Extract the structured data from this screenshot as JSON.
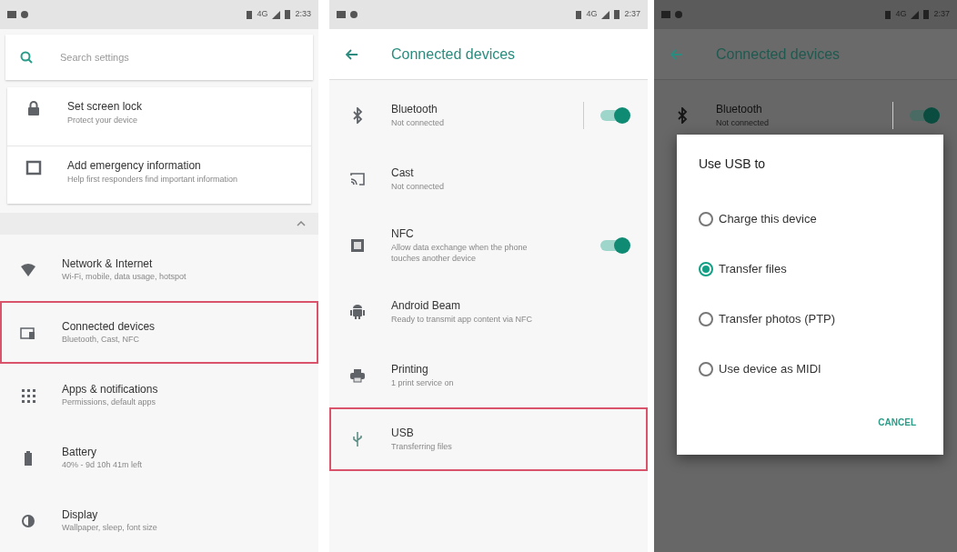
{
  "panels": [
    {
      "kind": "home",
      "status_bar": {
        "network": "4G",
        "time": "2:33"
      },
      "search": {
        "placeholder": "Search settings"
      },
      "suggestions": [
        {
          "title": "Set screen lock",
          "summary": "Protect your device"
        },
        {
          "title": "Add emergency information",
          "summary": "Help first responders find important information"
        }
      ],
      "items": [
        {
          "title": "Network & Internet",
          "summary": "Wi-Fi, mobile, data usage, hotspot",
          "highlighted": false
        },
        {
          "title": "Connected devices",
          "summary": "Bluetooth, Cast, NFC",
          "highlighted": true
        },
        {
          "title": "Apps & notifications",
          "summary": "Permissions, default apps",
          "highlighted": false
        },
        {
          "title": "Battery",
          "summary": "40% - 9d 10h 41m left",
          "highlighted": false
        },
        {
          "title": "Display",
          "summary": "Wallpaper, sleep, font size",
          "highlighted": false
        }
      ]
    },
    {
      "kind": "list",
      "status_bar": {
        "network": "4G",
        "time": "2:37"
      },
      "header": {
        "title": "Connected devices"
      },
      "items": [
        {
          "title": "Bluetooth",
          "summary": "Not connected",
          "highlighted": false,
          "on": true
        },
        {
          "title": "Cast",
          "summary": "Not connected",
          "highlighted": false
        },
        {
          "title": "NFC",
          "summary": "Allow data exchange when the phone touches another device",
          "highlighted": false,
          "on": true
        },
        {
          "title": "Android Beam",
          "summary": "Ready to transmit app content via NFC",
          "highlighted": false
        },
        {
          "title": "Printing",
          "summary": "1 print service on",
          "highlighted": false
        },
        {
          "title": "USB",
          "summary": "Transferring files",
          "highlighted": true
        }
      ]
    },
    {
      "kind": "dialog",
      "status_bar": {
        "network": "4G",
        "time": "2:37"
      },
      "header": {
        "title": "Connected devices"
      },
      "items": [
        {
          "title": "Bluetooth",
          "summary": "Not connected",
          "highlighted": false,
          "on": true
        }
      ],
      "dialog": {
        "title": "Use USB to",
        "options": [
          {
            "label": "Charge this device",
            "selected": false
          },
          {
            "label": "Transfer files",
            "selected": true
          },
          {
            "label": "Transfer photos (PTP)",
            "selected": false
          },
          {
            "label": "Use device as MIDI",
            "selected": false
          }
        ],
        "button": "CANCEL"
      }
    }
  ]
}
